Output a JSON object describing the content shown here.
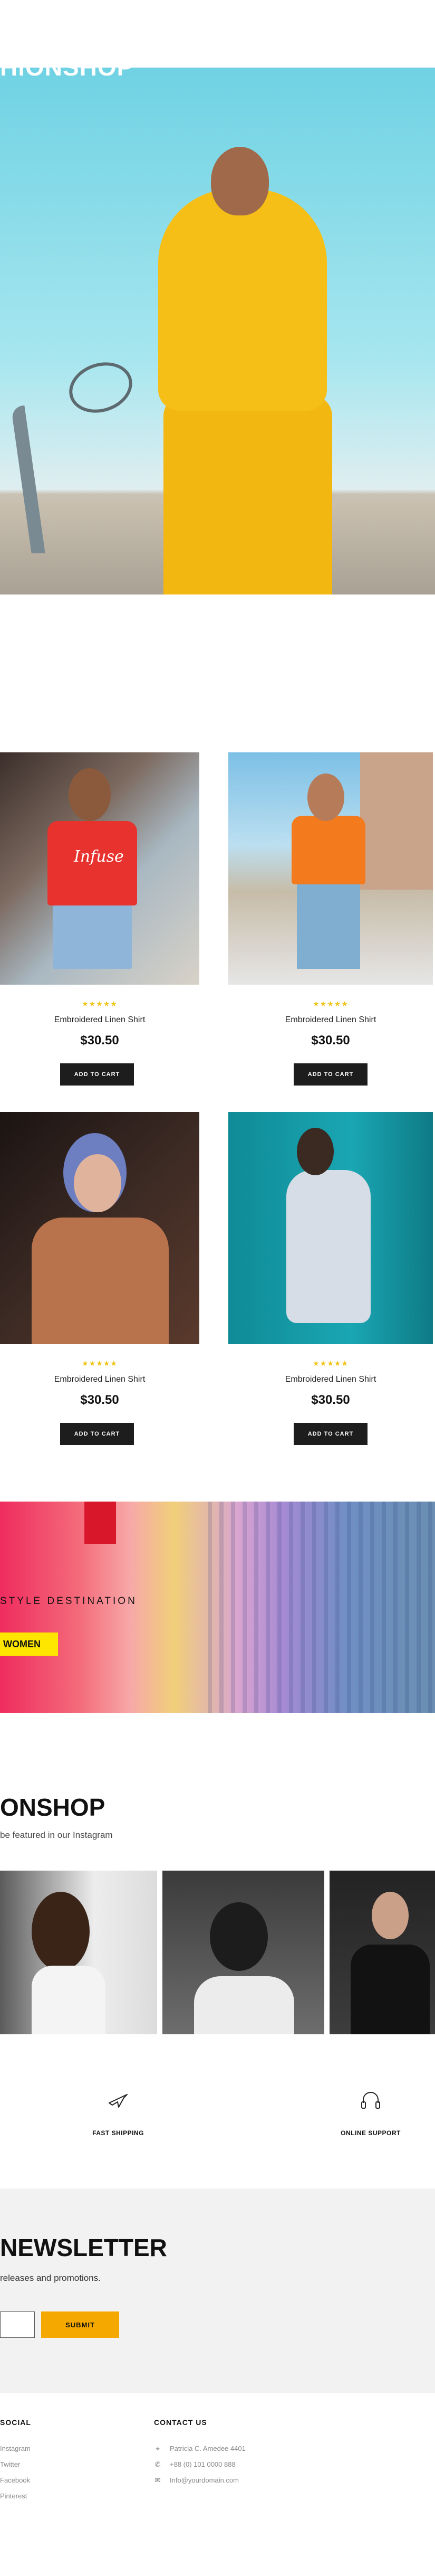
{
  "products": [
    {
      "rating": "★★★★★",
      "name": "Embroidered Linen Shirt",
      "price": "$30.50",
      "button": "ADD TO CART"
    },
    {
      "rating": "★★★★★",
      "name": "Embroidered Linen Shirt",
      "price": "$30.50",
      "button": "ADD TO CART"
    },
    {
      "rating": "★★★★★",
      "name": "Embroidered Linen Shirt",
      "price": "$30.50",
      "button": "ADD TO CART"
    },
    {
      "rating": "★★★★★",
      "name": "Embroidered Linen Shirt",
      "price": "$30.50",
      "button": "ADD TO CART"
    }
  ],
  "tee_print": "Infuse",
  "banner": {
    "title": "HIONSHOP",
    "subtitle": "STYLE DESTINATION",
    "button": "WOMEN"
  },
  "instagram": {
    "title": "ONSHOP",
    "subtitle": "be featured in our Instagram"
  },
  "features": [
    {
      "icon": "plane-icon",
      "label": "FAST SHIPPING"
    },
    {
      "icon": "headphones-icon",
      "label": "ONLINE SUPPORT"
    }
  ],
  "newsletter": {
    "title": "NEWSLETTER",
    "subtitle": "releases and promotions.",
    "email_placeholder": "",
    "submit": "SUBMIT"
  },
  "footer": {
    "social_heading": "SOCIAL",
    "social_links": [
      "Instagram",
      "Twitter",
      "Facebook",
      "Pinterest"
    ],
    "contact_heading": "CONTACT US",
    "contact": [
      {
        "icon": "location-icon",
        "text": "Patricia C. Amedee 4401"
      },
      {
        "icon": "phone-icon",
        "text": "+88 (0) 101 0000 888"
      },
      {
        "icon": "mail-icon",
        "text": "Info@yourdomain.com"
      }
    ]
  },
  "colors": {
    "accent_yellow": "#f5a900",
    "banner_button": "#ffe600",
    "star": "#f0c419",
    "dark_button": "#1d1d1d"
  }
}
